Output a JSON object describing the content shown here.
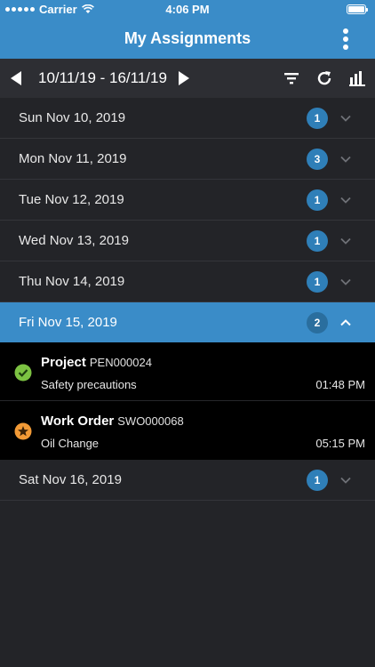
{
  "status_bar": {
    "carrier": "Carrier",
    "time": "4:06 PM"
  },
  "nav": {
    "title": "My Assignments"
  },
  "toolbar": {
    "date_range": "10/11/19 - 16/11/19"
  },
  "days": [
    {
      "label": "Sun Nov 10, 2019",
      "count": "1"
    },
    {
      "label": "Mon Nov 11, 2019",
      "count": "3"
    },
    {
      "label": "Tue Nov 12, 2019",
      "count": "1"
    },
    {
      "label": "Wed Nov 13, 2019",
      "count": "1"
    },
    {
      "label": "Thu Nov 14, 2019",
      "count": "1"
    },
    {
      "label": "Fri Nov 15, 2019",
      "count": "2"
    },
    {
      "label": "Sat Nov 16, 2019",
      "count": "1"
    }
  ],
  "assignments": [
    {
      "type": "Project",
      "id": "PEN000024",
      "description": "Safety precautions",
      "time": "01:48 PM",
      "status": "check-icon",
      "color": "#7cc242"
    },
    {
      "type": "Work Order",
      "id": "SWO000068",
      "description": "Oil Change",
      "time": "05:15 PM",
      "status": "star-icon",
      "color": "#f29a36"
    }
  ],
  "colors": {
    "accent": "#3a8cc8",
    "background": "#232428",
    "badge": "#2f7fb8"
  }
}
